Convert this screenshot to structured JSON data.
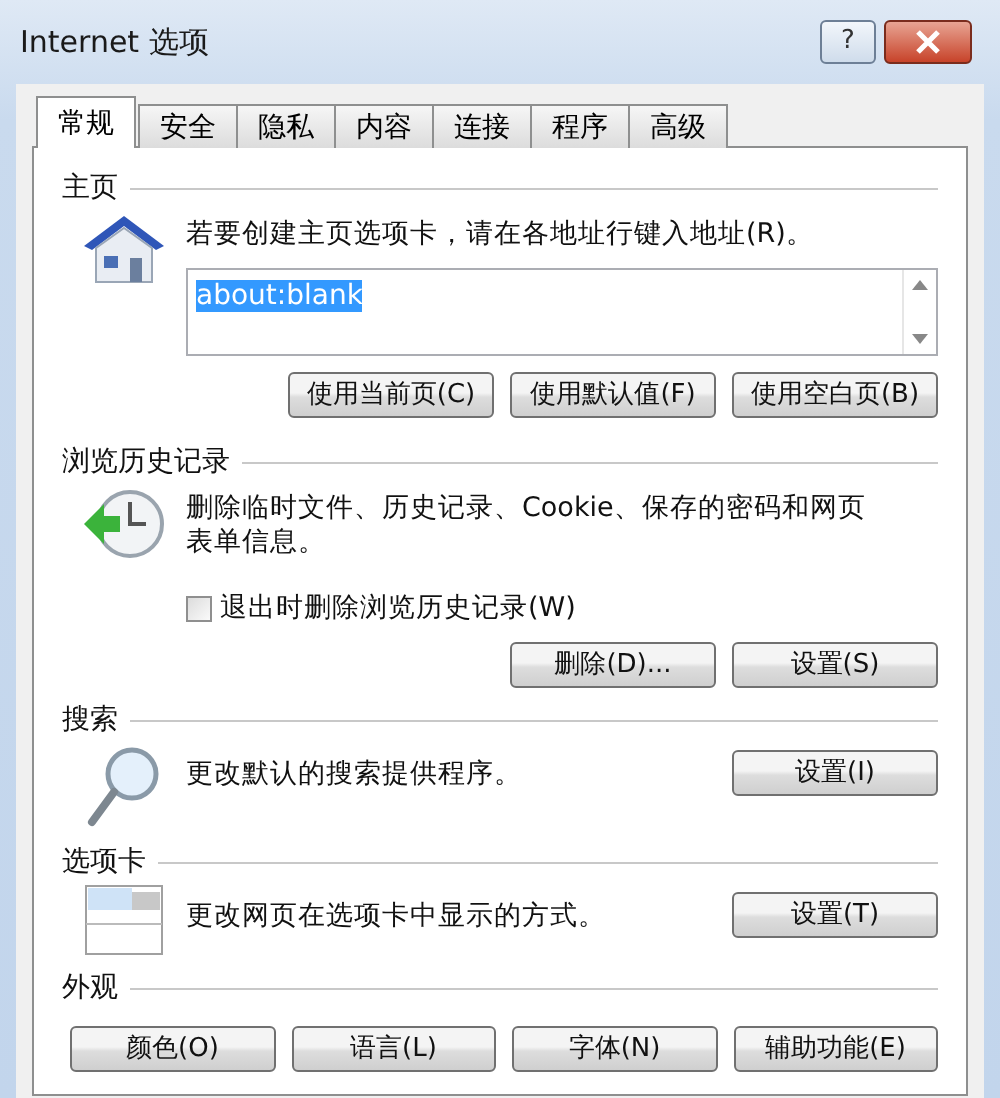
{
  "window": {
    "title": "Internet 选项",
    "help_label": "?"
  },
  "tabs": [
    {
      "label": "常规",
      "selected": true
    },
    {
      "label": "安全",
      "selected": false
    },
    {
      "label": "隐私",
      "selected": false
    },
    {
      "label": "内容",
      "selected": false
    },
    {
      "label": "连接",
      "selected": false
    },
    {
      "label": "程序",
      "selected": false
    },
    {
      "label": "高级",
      "selected": false
    }
  ],
  "sections": [
    {
      "kind": "homepage",
      "title": "主页",
      "description": "若要创建主页选项卡，请在各地址行键入地址(R)。",
      "address": {
        "value": "about:blank",
        "selected": true
      },
      "buttons": [
        "使用当前页(C)",
        "使用默认值(F)",
        "使用空白页(B)"
      ]
    },
    {
      "kind": "history",
      "title": "浏览历史记录",
      "description": "删除临时文件、历史记录、Cookie、保存的密码和网页表单信息。",
      "checkbox": {
        "label": "退出时删除浏览历史记录(W)",
        "checked": false
      },
      "buttons": [
        "删除(D)...",
        "设置(S)"
      ]
    },
    {
      "kind": "search",
      "title": "搜索",
      "description": "更改默认的搜索提供程序。",
      "buttons": [
        "设置(I)"
      ]
    },
    {
      "kind": "tabs",
      "title": "选项卡",
      "description": "更改网页在选项卡中显示的方式。",
      "buttons": [
        "设置(T)"
      ]
    },
    {
      "kind": "appearance",
      "title": "外观",
      "buttons": [
        "颜色(O)",
        "语言(L)",
        "字体(N)",
        "辅助功能(E)"
      ]
    }
  ]
}
